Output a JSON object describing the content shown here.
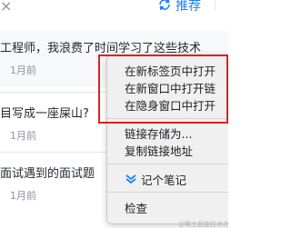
{
  "topbar": {
    "recommend_label": "推荐"
  },
  "feed": [
    {
      "title": "工程师，我浪费了时间学习了这些技术",
      "meta": "1月前"
    },
    {
      "title": "目写成一座屎山?",
      "meta": "1月前"
    },
    {
      "title": "面试遇到的面试题",
      "meta": "1月前"
    }
  ],
  "context_menu": {
    "items": [
      "在新标签页中打开",
      "在新窗口中打开链",
      "在隐身窗口中打开",
      "链接存储为...",
      "复制链接地址",
      "记个笔记",
      "检查"
    ]
  },
  "watermark": "@稀土掘金技术社区",
  "colors": {
    "accent": "#1e80ff",
    "highlight_border": "#e02020",
    "note_icon": "#1e80ff"
  }
}
